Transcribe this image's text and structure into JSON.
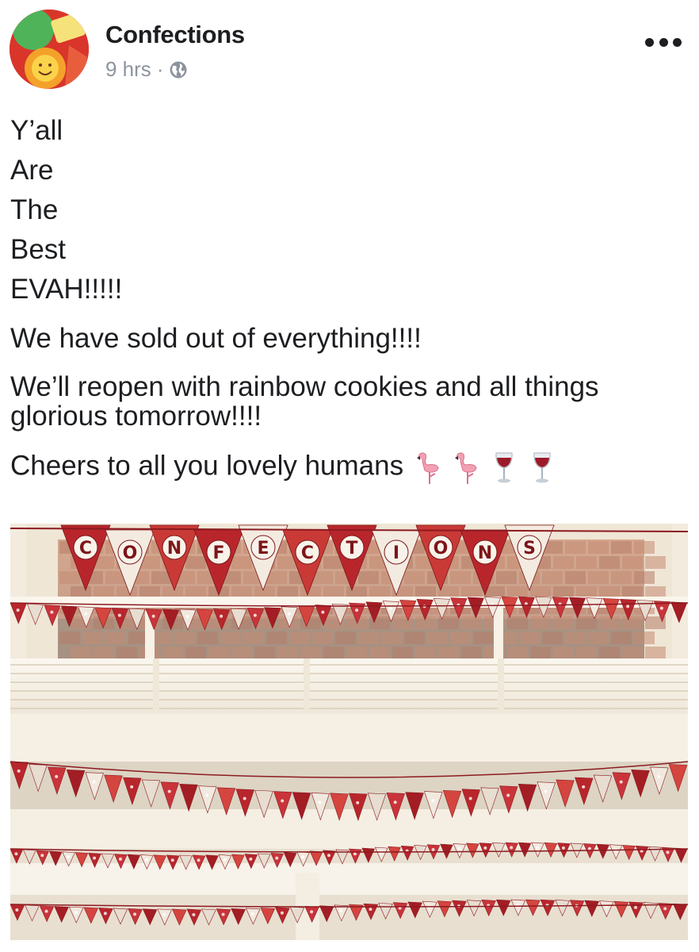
{
  "post": {
    "author": "Confections",
    "time": "9 hrs",
    "separator": "·",
    "audience_icon": "globe-icon",
    "menu_icon": "more-options-icon",
    "lines": [
      "Y’all",
      "Are",
      "The",
      "Best",
      "EVAH!!!!!"
    ],
    "paragraph_1": "We have sold out of everything!!!!",
    "paragraph_2": "We’ll reopen with rainbow cookies and all things glorious tomorrow!!!!",
    "paragraph_3": "Cheers to all you lovely humans",
    "emojis": [
      "flamingo",
      "flamingo",
      "wine-glass",
      "wine-glass"
    ],
    "photo": {
      "banner_letters": [
        "C",
        "O",
        "N",
        "F",
        "E",
        "C",
        "T",
        "I",
        "O",
        "N",
        "S"
      ],
      "banner_color": "#b8262c",
      "shelf_color": "#f4efe6"
    }
  }
}
